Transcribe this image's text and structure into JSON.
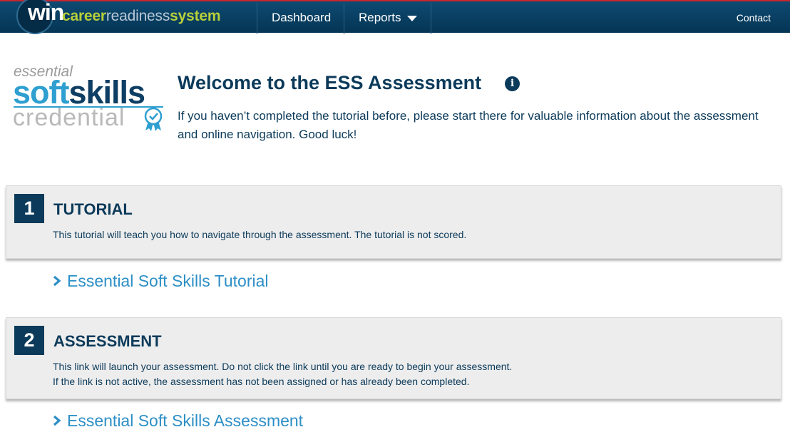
{
  "header": {
    "brand": {
      "logo_text": "win",
      "career": "career",
      "readiness": "readiness",
      "system": "system"
    },
    "nav": {
      "dashboard": "Dashboard",
      "reports": "Reports",
      "contact": "Contact"
    }
  },
  "ess_logo": {
    "line1": "essential",
    "soft": "soft",
    "skills": "skills",
    "line3": "credential",
    "badge_icon": "award-ribbon-icon"
  },
  "welcome": {
    "title": "Welcome to the ESS Assessment",
    "info_icon": "info-icon",
    "body": "If you haven’t completed the tutorial before, please start there for valuable information about the assessment and online navigation. Good luck!"
  },
  "steps": [
    {
      "number": "1",
      "title": "TUTORIAL",
      "desc_lines": [
        "This tutorial will teach you how to navigate through the assessment. The tutorial is not scored."
      ],
      "link": "Essential Soft Skills Tutorial"
    },
    {
      "number": "2",
      "title": "ASSESSMENT",
      "desc_lines": [
        "This link will launch your assessment. Do not click the link until you are ready to begin your assessment.",
        "If the link is not active, the assessment has not been assigned or has already been completed."
      ],
      "link": "Essential Soft Skills Assessment"
    }
  ],
  "colors": {
    "navy": "#0b3a5a",
    "topbar": "#0e4a72",
    "accent_red": "#c6262e",
    "brand_green": "#b7cf3a",
    "link_blue": "#2d8fc6",
    "panel_bg": "#ededed"
  }
}
